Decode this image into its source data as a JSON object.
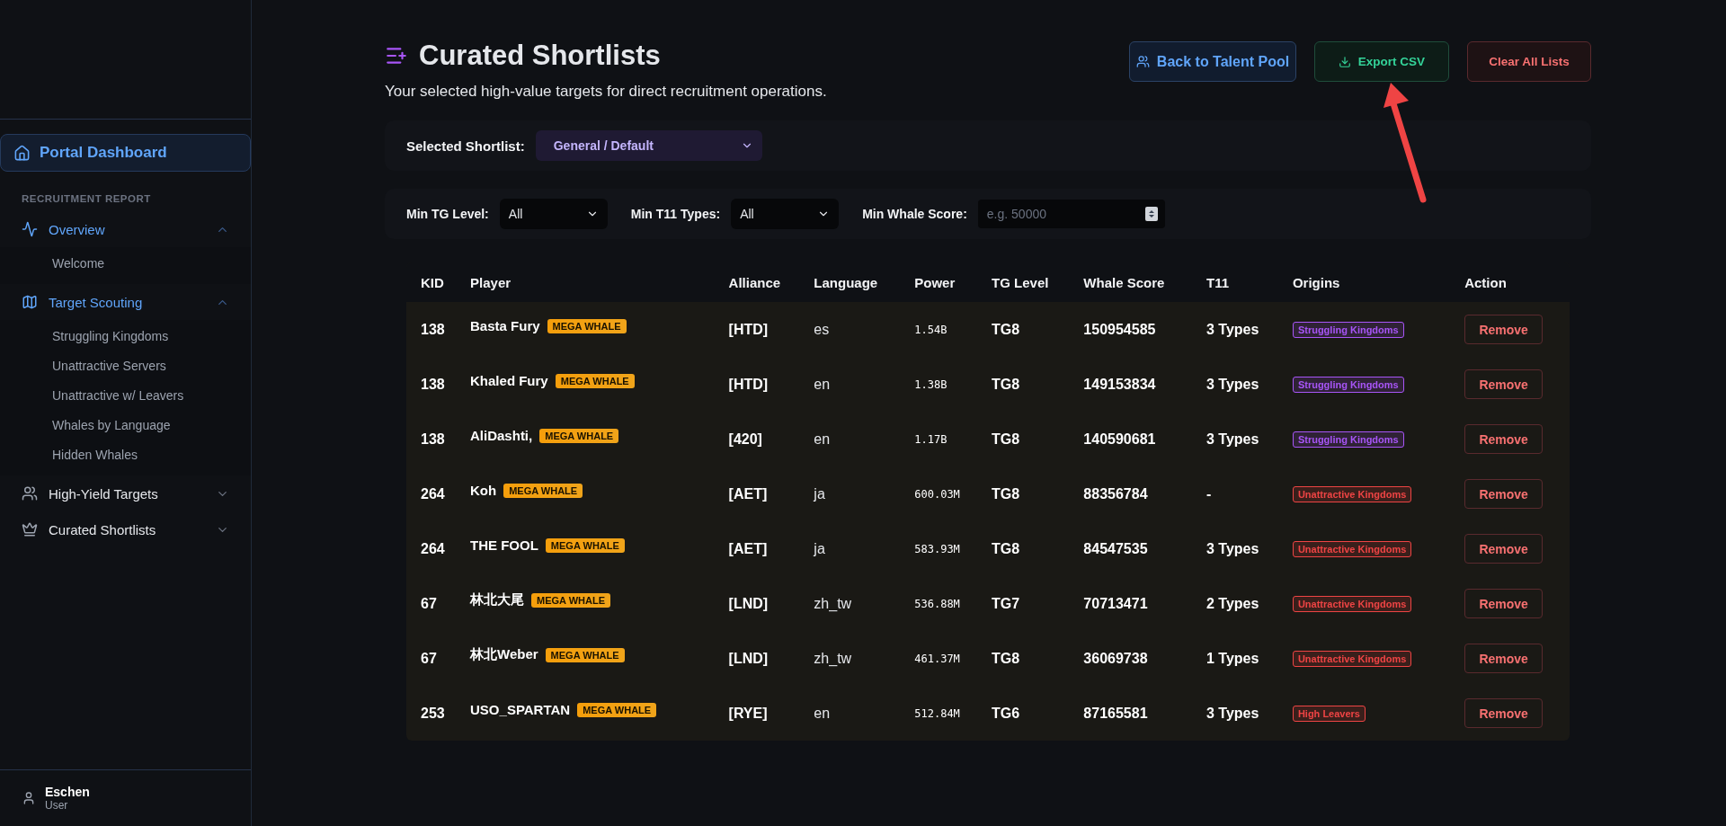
{
  "sidebar": {
    "home": {
      "label": "Portal Dashboard",
      "selected": true
    },
    "section_title": "RECRUITMENT REPORT",
    "groups": [
      {
        "label": "Overview",
        "expanded": true,
        "children": [
          {
            "label": "Welcome"
          }
        ]
      },
      {
        "label": "Target Scouting",
        "expanded": true,
        "children": [
          {
            "label": "Struggling Kingdoms"
          },
          {
            "label": "Unattractive Servers"
          },
          {
            "label": "Unattractive w/ Leavers"
          },
          {
            "label": "Whales by Language"
          },
          {
            "label": "Hidden Whales"
          }
        ]
      },
      {
        "label": "High-Yield Targets",
        "expanded": false
      },
      {
        "label": "Curated Shortlists",
        "expanded": false
      }
    ],
    "user": {
      "name": "Eschen",
      "role": "User"
    }
  },
  "header": {
    "title": "Curated Shortlists",
    "subtitle": "Your selected high-value targets for direct recruitment operations.",
    "buttons": [
      {
        "label": "Back to Talent Pool",
        "kind": "primary"
      },
      {
        "label": "Export CSV",
        "kind": "export"
      },
      {
        "label": "Clear All Lists",
        "kind": "danger"
      }
    ]
  },
  "shortlist": {
    "label": "Selected Shortlist:",
    "value": "General / Default"
  },
  "filters": [
    {
      "kind": "select",
      "label": "Min TG Level:",
      "value": "All"
    },
    {
      "kind": "select",
      "label": "Min T11 Types:",
      "value": "All"
    },
    {
      "kind": "number",
      "label": "Min Whale Score:",
      "placeholder": "e.g. 50000"
    }
  ],
  "table": {
    "columns": [
      "KID",
      "Player",
      "Alliance",
      "Language",
      "Power",
      "TG Level",
      "Whale Score",
      "T11",
      "Origins",
      "Action"
    ],
    "rows": [
      {
        "kid": "138",
        "player": "Basta Fury",
        "badge": "MEGA WHALE",
        "alliance": "[HTD]",
        "language": "es",
        "power": "1.54B",
        "tg_level": "TG8",
        "whale_score": "150954585",
        "t11": "3 Types",
        "origin": {
          "label": "Struggling Kingdoms",
          "color": "#a855f7"
        },
        "action": "Remove"
      },
      {
        "kid": "138",
        "player": "Khaled Fury",
        "badge": "MEGA WHALE",
        "alliance": "[HTD]",
        "language": "en",
        "power": "1.38B",
        "tg_level": "TG8",
        "whale_score": "149153834",
        "t11": "3 Types",
        "origin": {
          "label": "Struggling Kingdoms",
          "color": "#a855f7"
        },
        "action": "Remove"
      },
      {
        "kid": "138",
        "player": "AliDashti,",
        "badge": "MEGA WHALE",
        "alliance": "[420]",
        "language": "en",
        "power": "1.17B",
        "tg_level": "TG8",
        "whale_score": "140590681",
        "t11": "3 Types",
        "origin": {
          "label": "Struggling Kingdoms",
          "color": "#a855f7"
        },
        "action": "Remove"
      },
      {
        "kid": "264",
        "player": "Koh",
        "badge": "MEGA WHALE",
        "alliance": "[AET]",
        "language": "ja",
        "power": "600.03M",
        "tg_level": "TG8",
        "whale_score": "88356784",
        "t11": "-",
        "origin": {
          "label": "Unattractive Kingdoms",
          "color": "#ef4444"
        },
        "action": "Remove"
      },
      {
        "kid": "264",
        "player": "THE FOOL",
        "badge": "MEGA WHALE",
        "alliance": "[AET]",
        "language": "ja",
        "power": "583.93M",
        "tg_level": "TG8",
        "whale_score": "84547535",
        "t11": "3 Types",
        "origin": {
          "label": "Unattractive Kingdoms",
          "color": "#ef4444"
        },
        "action": "Remove"
      },
      {
        "kid": "67",
        "player": "林北大尾",
        "badge": "MEGA WHALE",
        "alliance": "[LND]",
        "language": "zh_tw",
        "power": "536.88M",
        "tg_level": "TG7",
        "whale_score": "70713471",
        "t11": "2 Types",
        "origin": {
          "label": "Unattractive Kingdoms",
          "color": "#ef4444"
        },
        "action": "Remove"
      },
      {
        "kid": "67",
        "player": "林北Weber",
        "badge": "MEGA WHALE",
        "alliance": "[LND]",
        "language": "zh_tw",
        "power": "461.37M",
        "tg_level": "TG8",
        "whale_score": "36069738",
        "t11": "1 Types",
        "origin": {
          "label": "Unattractive Kingdoms",
          "color": "#ef4444"
        },
        "action": "Remove"
      },
      {
        "kid": "253",
        "player": "USO_SPARTAN",
        "badge": "MEGA WHALE",
        "alliance": "[RYE]",
        "language": "en",
        "power": "512.84M",
        "tg_level": "TG6",
        "whale_score": "87165581",
        "t11": "3 Types",
        "origin": {
          "label": "High Leavers",
          "color": "#ef4444"
        },
        "action": "Remove"
      }
    ]
  }
}
